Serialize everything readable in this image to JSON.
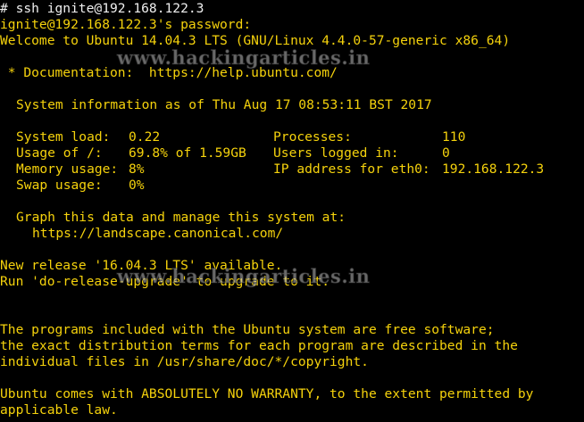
{
  "terminal": {
    "lines": {
      "cmd": "# ssh ignite@192.168.122.3",
      "password_prompt": "ignite@192.168.122.3's password:",
      "welcome": "Welcome to Ubuntu 14.04.3 LTS (GNU/Linux 4.4.0-57-generic x86_64)",
      "documentation": " * Documentation:  https://help.ubuntu.com/",
      "sysinfo": "System information as of Thu Aug 17 08:53:11 BST 2017",
      "graph": "Graph this data and manage this system at:",
      "landscape_url": "https://landscape.canonical.com/",
      "new_release": "New release '16.04.3 LTS' available.",
      "run_upgrade": "Run 'do-release-upgrade' to upgrade to it.",
      "programs_1": "The programs included with the Ubuntu system are free software;",
      "programs_2": "the exact distribution terms for each program are described in the",
      "programs_3": "individual files in /usr/share/doc/*/copyright.",
      "warranty_1": "Ubuntu comes with ABSOLUTELY NO WARRANTY, to the extent permitted by",
      "warranty_2": "applicable law."
    },
    "stats": {
      "system_load_label": "System load:",
      "system_load_value": "0.22",
      "usage_label": "Usage of /:",
      "usage_value": "69.8% of 1.59GB",
      "memory_label": "Memory usage:",
      "memory_value": "8%",
      "swap_label": "Swap usage:",
      "swap_value": "0%",
      "processes_label": "Processes:",
      "processes_value": "110",
      "users_label": "Users logged in:",
      "users_value": "0",
      "ip_label": "IP address for eth0:",
      "ip_value": "192.168.122.3"
    },
    "watermark": "www.hackingarticles.in",
    "colors": {
      "background": "#000000",
      "text": "#f5d20c",
      "command_text": "#f0f0f0"
    }
  }
}
